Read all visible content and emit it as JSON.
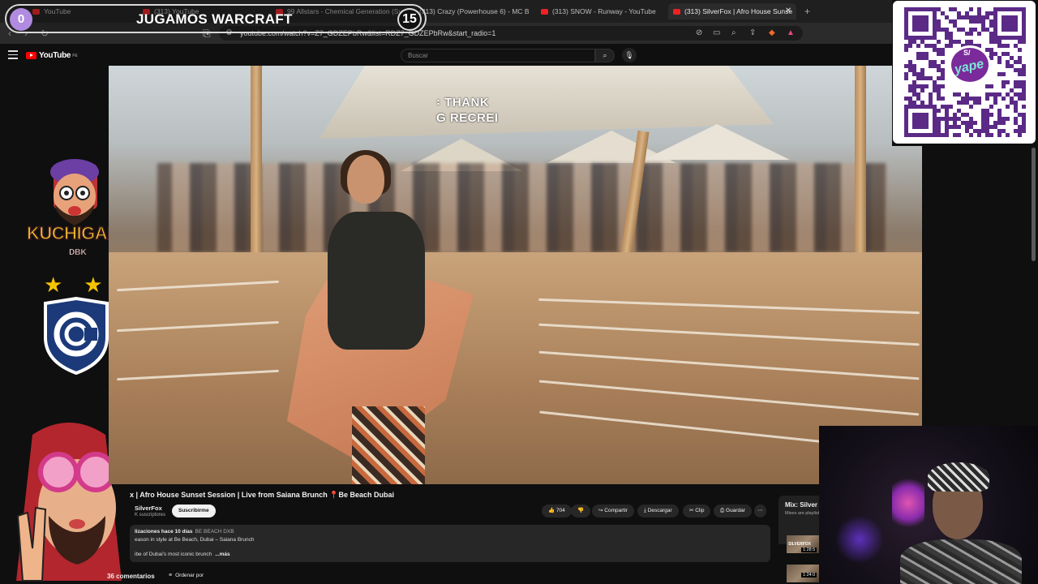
{
  "browser": {
    "tabs": [
      {
        "label": "YouTube",
        "x_hint": "first"
      },
      {
        "label": "(313) YouTube"
      },
      {
        "label": "99 Allstars - Chemical Generation (Sy..."
      },
      {
        "label": "(313) Crazy (Powerhouse 6) - MC B F..."
      },
      {
        "label": "(313) SNOW - Runway - YouTube"
      },
      {
        "label": "(313) SilverFox | Afro House Sunse"
      }
    ],
    "url": "youtube.com/watch?v=Z7_GDZEPbRw&list=RDZ7_GDZEPbRw&start_radio=1"
  },
  "overlay": {
    "left_count": "0",
    "title": "JUGAMOS WARCRAFT",
    "right_count": "15",
    "brand": "KUCHIGANG",
    "brand_sub": "DBK",
    "qr_brand": "yape",
    "qr_badge": "S/"
  },
  "youtube": {
    "logo": "YouTube",
    "logo_region": "PE",
    "search_placeholder": "Buscar",
    "video_caption_line1": "꞉ THANK",
    "video_caption_line2": "G RECREI",
    "video_title": "x | Afro House Sunset Session | Live from Saiana Brunch 📍Be Beach Dubai",
    "channel_name": "SilverFox",
    "channel_subs": "K suscriptores",
    "subscribe_label": "Suscribirme",
    "likes": "704",
    "share_label": "Compartir",
    "download_label": "Descargar",
    "clip_label": "Clip",
    "save_label": "Guardar",
    "more_label": "⋯",
    "desc_views": "lizaciones  hace 10 días",
    "desc_tag": "BE BEACH DXB",
    "desc_line2": "eason in style at Be Beach, Dubai – Saiana Brunch",
    "desc_line3": "ibe of Dubai's most iconic brunch",
    "desc_more": "...más",
    "comments_count": "36 comentarios",
    "sort_label": "Ordenar por",
    "mix_title": "Mix: Silver",
    "mix_sub": "Mixes are playlists",
    "mix_time1": "1:28:5",
    "mix_time2": "1:24:0",
    "mix_thumb_label": "SILVERFOX"
  },
  "colors": {
    "background": "#0f0f0f",
    "accent_red": "#ff0000",
    "counter_purple": "#b08be0",
    "yape_purple": "#7a2a9a",
    "brand_gold": "#ffcc33"
  }
}
